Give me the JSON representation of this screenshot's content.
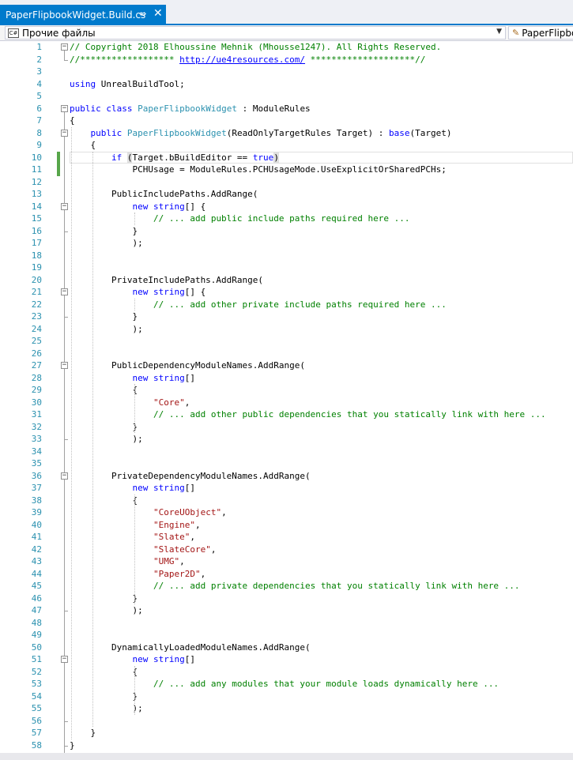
{
  "tab": {
    "title": "PaperFlipbookWidget.Build.cs",
    "pin": "⇔",
    "close": "✕"
  },
  "navbar": {
    "left_badge": "C#",
    "left_value": "Прочие файлы",
    "right_value": "PaperFlipbo"
  },
  "colors": {
    "accent": "#007acc",
    "keyword": "#0000ff",
    "type": "#2b91af",
    "comment": "#008000",
    "string": "#a31515"
  },
  "lines": [
    [
      [
        "c",
        "// Copyright 2018 Elhoussine Mehnik (Mhousse1247). All Rights Reserved."
      ]
    ],
    [
      [
        "c",
        "//****************** "
      ],
      [
        "l",
        "http://ue4resources.com/"
      ],
      [
        "c",
        " ********************//"
      ]
    ],
    [],
    [
      [
        "k",
        "using"
      ],
      [
        "p",
        " UnrealBuildTool;"
      ]
    ],
    [],
    [
      [
        "k",
        "public"
      ],
      [
        "p",
        " "
      ],
      [
        "k",
        "class"
      ],
      [
        "p",
        " "
      ],
      [
        "t",
        "PaperFlipbookWidget"
      ],
      [
        "p",
        " : ModuleRules"
      ]
    ],
    [
      [
        "p",
        "{"
      ]
    ],
    [
      [
        "p",
        "    "
      ],
      [
        "k",
        "public"
      ],
      [
        "p",
        " "
      ],
      [
        "t",
        "PaperFlipbookWidget"
      ],
      [
        "p",
        "(ReadOnlyTargetRules Target) : "
      ],
      [
        "k",
        "base"
      ],
      [
        "p",
        "(Target)"
      ]
    ],
    [
      [
        "p",
        "    {"
      ]
    ],
    [
      [
        "p",
        "        "
      ],
      [
        "k",
        "if"
      ],
      [
        "p",
        " "
      ],
      [
        "b",
        "("
      ],
      [
        "p",
        "Target.bBuildEditor == "
      ],
      [
        "k",
        "true"
      ],
      [
        "b",
        ")"
      ]
    ],
    [
      [
        "p",
        "            PCHUsage = ModuleRules.PCHUsageMode.UseExplicitOrSharedPCHs;"
      ]
    ],
    [],
    [
      [
        "p",
        "        PublicIncludePaths.AddRange("
      ]
    ],
    [
      [
        "p",
        "            "
      ],
      [
        "k",
        "new"
      ],
      [
        "p",
        " "
      ],
      [
        "k",
        "string"
      ],
      [
        "p",
        "[] {"
      ]
    ],
    [
      [
        "p",
        "                "
      ],
      [
        "c",
        "// ... add public include paths required here ..."
      ]
    ],
    [
      [
        "p",
        "            }"
      ]
    ],
    [
      [
        "p",
        "            );"
      ]
    ],
    [],
    [],
    [
      [
        "p",
        "        PrivateIncludePaths.AddRange("
      ]
    ],
    [
      [
        "p",
        "            "
      ],
      [
        "k",
        "new"
      ],
      [
        "p",
        " "
      ],
      [
        "k",
        "string"
      ],
      [
        "p",
        "[] {"
      ]
    ],
    [
      [
        "p",
        "                "
      ],
      [
        "c",
        "// ... add other private include paths required here ..."
      ]
    ],
    [
      [
        "p",
        "            }"
      ]
    ],
    [
      [
        "p",
        "            );"
      ]
    ],
    [],
    [],
    [
      [
        "p",
        "        PublicDependencyModuleNames.AddRange("
      ]
    ],
    [
      [
        "p",
        "            "
      ],
      [
        "k",
        "new"
      ],
      [
        "p",
        " "
      ],
      [
        "k",
        "string"
      ],
      [
        "p",
        "[]"
      ]
    ],
    [
      [
        "p",
        "            {"
      ]
    ],
    [
      [
        "p",
        "                "
      ],
      [
        "s",
        "\"Core\""
      ],
      [
        "p",
        ","
      ]
    ],
    [
      [
        "p",
        "                "
      ],
      [
        "c",
        "// ... add other public dependencies that you statically link with here ..."
      ]
    ],
    [
      [
        "p",
        "            }"
      ]
    ],
    [
      [
        "p",
        "            );"
      ]
    ],
    [],
    [],
    [
      [
        "p",
        "        PrivateDependencyModuleNames.AddRange("
      ]
    ],
    [
      [
        "p",
        "            "
      ],
      [
        "k",
        "new"
      ],
      [
        "p",
        " "
      ],
      [
        "k",
        "string"
      ],
      [
        "p",
        "[]"
      ]
    ],
    [
      [
        "p",
        "            {"
      ]
    ],
    [
      [
        "p",
        "                "
      ],
      [
        "s",
        "\"CoreUObject\""
      ],
      [
        "p",
        ","
      ]
    ],
    [
      [
        "p",
        "                "
      ],
      [
        "s",
        "\"Engine\""
      ],
      [
        "p",
        ","
      ]
    ],
    [
      [
        "p",
        "                "
      ],
      [
        "s",
        "\"Slate\""
      ],
      [
        "p",
        ","
      ]
    ],
    [
      [
        "p",
        "                "
      ],
      [
        "s",
        "\"SlateCore\""
      ],
      [
        "p",
        ","
      ]
    ],
    [
      [
        "p",
        "                "
      ],
      [
        "s",
        "\"UMG\""
      ],
      [
        "p",
        ","
      ]
    ],
    [
      [
        "p",
        "                "
      ],
      [
        "s",
        "\"Paper2D\""
      ],
      [
        "p",
        ","
      ]
    ],
    [
      [
        "p",
        "                "
      ],
      [
        "c",
        "// ... add private dependencies that you statically link with here ..."
      ]
    ],
    [
      [
        "p",
        "            }"
      ]
    ],
    [
      [
        "p",
        "            );"
      ]
    ],
    [],
    [],
    [
      [
        "p",
        "        DynamicallyLoadedModuleNames.AddRange("
      ]
    ],
    [
      [
        "p",
        "            "
      ],
      [
        "k",
        "new"
      ],
      [
        "p",
        " "
      ],
      [
        "k",
        "string"
      ],
      [
        "p",
        "[]"
      ]
    ],
    [
      [
        "p",
        "            {"
      ]
    ],
    [
      [
        "p",
        "                "
      ],
      [
        "c",
        "// ... add any modules that your module loads dynamically here ..."
      ]
    ],
    [
      [
        "p",
        "            }"
      ]
    ],
    [
      [
        "p",
        "            );"
      ]
    ],
    [],
    [
      [
        "p",
        "    }"
      ]
    ],
    [
      [
        "p",
        "}"
      ]
    ],
    []
  ]
}
